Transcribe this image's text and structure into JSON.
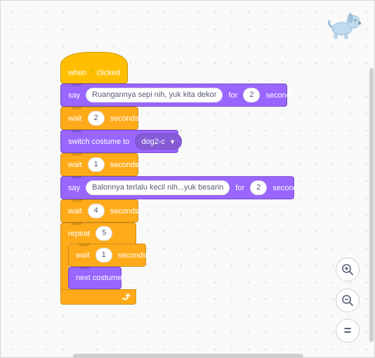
{
  "sprite_icon": "dog-sprite-icon",
  "blocks": {
    "when_flag": {
      "when": "when",
      "clicked": "clicked",
      "flag_icon": "green-flag-icon"
    },
    "say1": {
      "say": "say",
      "message": "Ruangannya sepi nih, yuk kita dekor",
      "for": "for",
      "secs": "2",
      "seconds": "seconds"
    },
    "wait1": {
      "wait": "wait",
      "value": "2",
      "seconds": "seconds"
    },
    "switch_costume": {
      "label": "switch costume to",
      "costume": "dog2-c"
    },
    "wait2": {
      "wait": "wait",
      "value": "1",
      "seconds": "seconds"
    },
    "say2": {
      "say": "say",
      "message": "Balonnya terlalu kecil nih...yuk besarin",
      "for": "for",
      "secs": "2",
      "seconds": "seconds"
    },
    "wait3": {
      "wait": "wait",
      "value": "4",
      "seconds": "seconds"
    },
    "repeat": {
      "label": "repeat",
      "times": "5"
    },
    "wait_inner": {
      "wait": "wait",
      "value": "1",
      "seconds": "seconds"
    },
    "next_costume": {
      "label": "next costume"
    },
    "loop_arrow_icon": "loop-arrow-icon"
  },
  "zoom": {
    "zoom_in_icon": "zoom-in-icon",
    "zoom_out_icon": "zoom-out-icon",
    "reset_icon": "zoom-reset-icon",
    "reset_label": "="
  },
  "colors": {
    "event": "#ffbf00",
    "looks": "#9966ff",
    "control": "#ffab19",
    "flag": "#4cbf56"
  }
}
